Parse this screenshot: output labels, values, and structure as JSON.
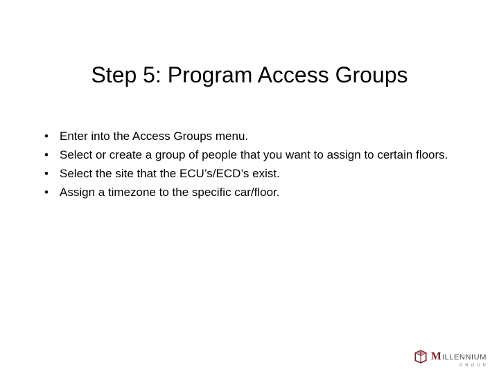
{
  "slide": {
    "title": "Step 5: Program Access Groups",
    "bullets": [
      "Enter into the Access Groups menu.",
      "Select or create a group of people that you want to assign to certain floors.",
      "Select the site that the ECU’s/ECD’s exist.",
      "Assign a timezone to the specific car/floor."
    ]
  },
  "logo": {
    "brand_first_letter": "M",
    "brand_rest": "ILLENNIUM",
    "subtext": "G R O U P",
    "color_primary": "#7a1c27",
    "color_secondary": "#4a4a4a"
  }
}
